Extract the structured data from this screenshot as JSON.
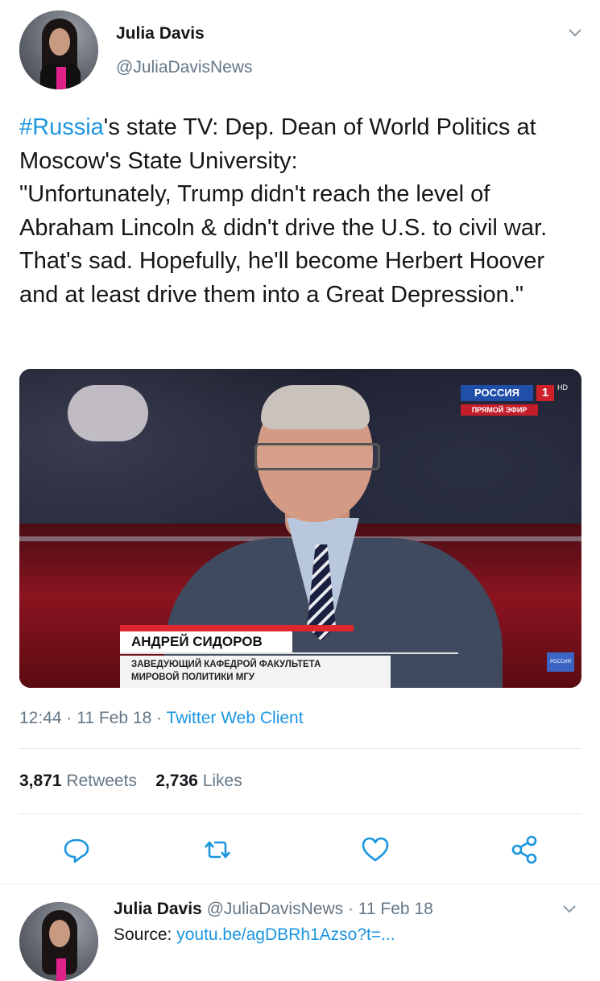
{
  "tweet": {
    "author_name": "Julia Davis",
    "author_handle": "@JuliaDavisNews",
    "hashtag": "#Russia",
    "text_rest": "'s state TV: Dep. Dean of World Politics at Moscow's State University:\n\"Unfortunately, Trump didn't reach the level of Abraham Lincoln & didn't drive the U.S. to civil war. That's sad. Hopefully, he'll become Herbert Hoover and at least drive them into a Great Depression.\"",
    "media": {
      "channel": "РОССИЯ",
      "channel_number": "1",
      "hd": "HD",
      "live": "ПРЯМОЙ ЭФИР",
      "caption_name": "АНДРЕЙ СИДОРОВ",
      "caption_title": "ЗАВЕДУЮЩИЙ КАФЕДРОЙ ФАКУЛЬТЕТА\nМИРОВОЙ ПОЛИТИКИ МГУ",
      "corner_logo": "РОССИЯ"
    },
    "time": "12:44",
    "date": "11 Feb 18",
    "client": "Twitter Web Client",
    "retweets_count": "3,871",
    "retweets_label": "Retweets",
    "likes_count": "2,736",
    "likes_label": "Likes"
  },
  "reply": {
    "author_name": "Julia Davis",
    "author_handle": "@JuliaDavisNews",
    "date": "11 Feb 18",
    "source_label": "Source:",
    "source_link": "youtu.be/agDBRh1Azso?t=..."
  },
  "icons": [
    "chevron-down-icon",
    "reply-icon",
    "retweet-icon",
    "like-icon",
    "share-icon"
  ],
  "colors": {
    "link": "#1b95e0",
    "muted": "#657786",
    "text": "#14171a"
  }
}
